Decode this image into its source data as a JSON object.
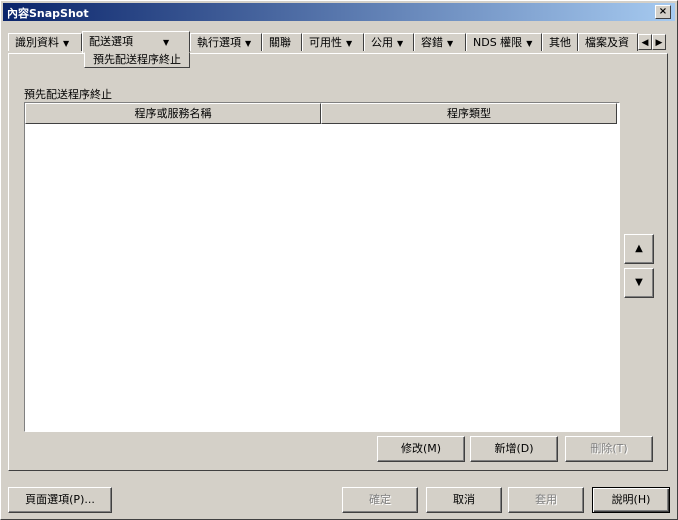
{
  "window": {
    "title": "內容SnapShot",
    "close_label": "×"
  },
  "tabs": [
    {
      "label": "識別資料",
      "has_menu": true
    },
    {
      "label": "配送選項",
      "has_menu": true,
      "active": true
    },
    {
      "label": "執行選項",
      "has_menu": true
    },
    {
      "label": "關聯",
      "has_menu": false
    },
    {
      "label": "可用性",
      "has_menu": true
    },
    {
      "label": "公用",
      "has_menu": true
    },
    {
      "label": "容錯",
      "has_menu": true
    },
    {
      "label": "NDS 權限",
      "has_menu": true
    },
    {
      "label": "其他",
      "has_menu": false
    },
    {
      "label": "檔案及資",
      "has_menu": false
    }
  ],
  "subtab": {
    "label": "預先配送程序終止"
  },
  "tab_scroll": {
    "left": "◀",
    "right": "▶"
  },
  "section": {
    "label": "預先配送程序終止"
  },
  "table": {
    "columns": [
      "程序或服務名稱",
      "程序類型"
    ],
    "rows": []
  },
  "list_buttons": {
    "up": "▲",
    "down": "▼"
  },
  "actions": {
    "modify": "修改(M)",
    "add": "新增(D)",
    "delete": "刪除(T)"
  },
  "footer": {
    "page_options": "頁面選項(P)...",
    "ok": "確定",
    "cancel": "取消",
    "apply": "套用",
    "help": "說明(H)"
  }
}
